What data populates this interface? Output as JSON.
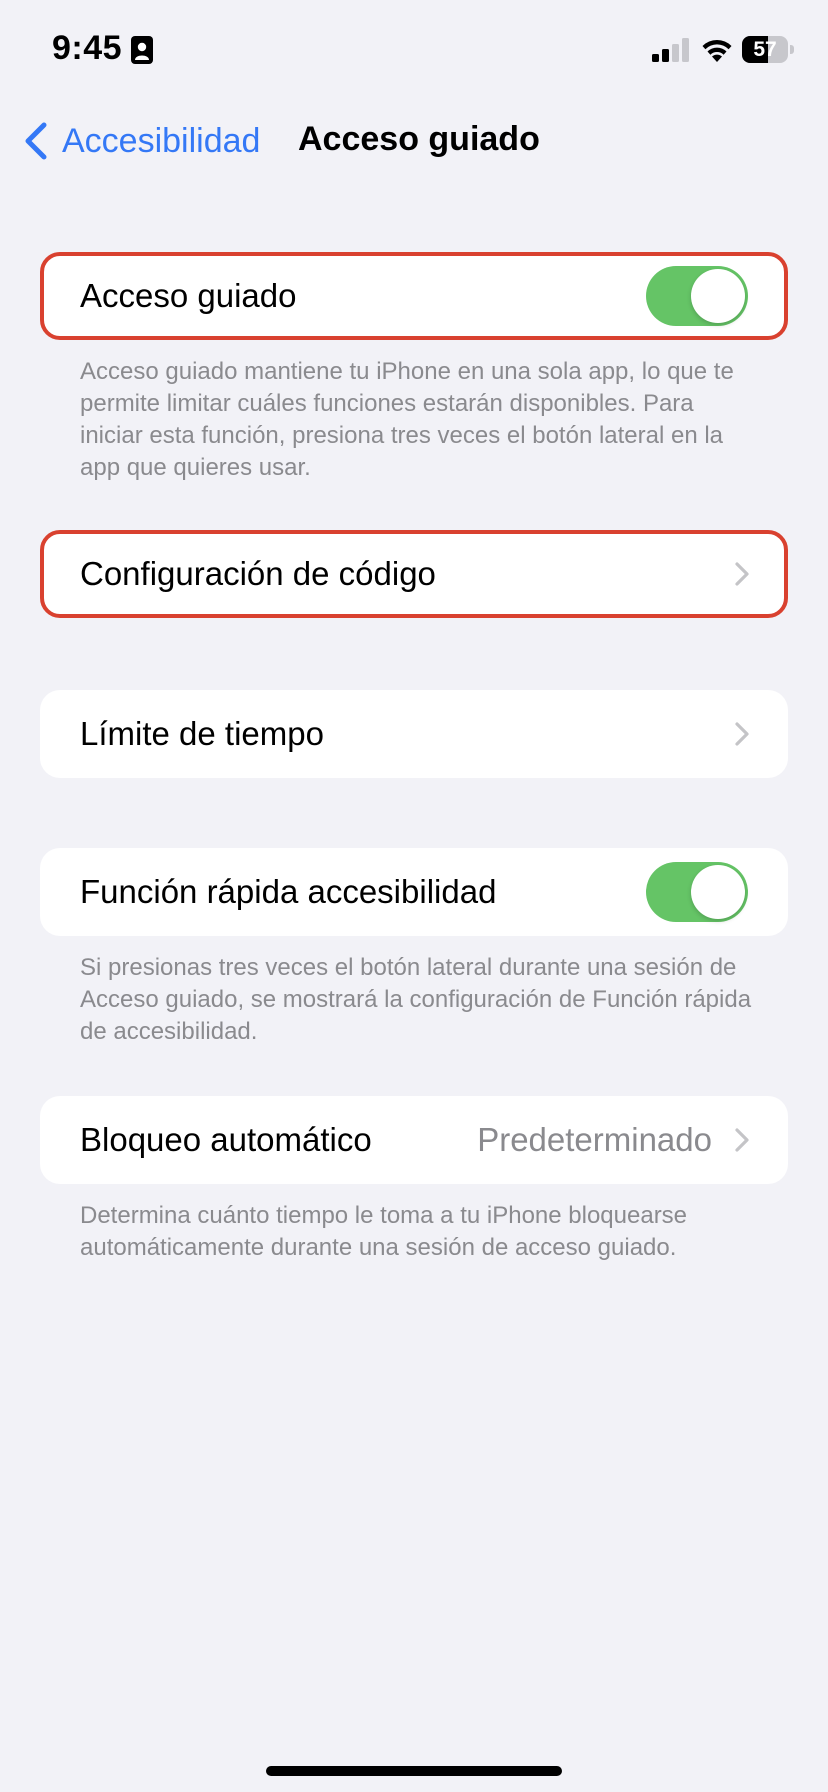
{
  "status_bar": {
    "time": "9:45",
    "battery_level": "57",
    "battery_fraction": 0.57,
    "icons": [
      "focus-person-icon",
      "cellular-signal-icon",
      "wifi-icon",
      "battery-icon"
    ]
  },
  "nav": {
    "back_label": "Accesibilidad",
    "title": "Acceso guiado",
    "back_icon": "chevron-left-icon"
  },
  "sections": {
    "guided_access": {
      "label": "Acceso guiado",
      "toggle_on": true,
      "footer": "Acceso guiado mantiene tu iPhone en una sola app, lo que te permite limitar cuáles funciones estarán disponibles. Para iniciar esta función, presiona tres veces el botón lateral en la app que quieres usar."
    },
    "passcode": {
      "label": "Configuración de código"
    },
    "time_limit": {
      "label": "Límite de tiempo"
    },
    "accessibility_shortcut": {
      "label": "Función rápida accesibilidad",
      "toggle_on": true,
      "footer": "Si presionas tres veces el botón lateral durante una sesión de Acceso guiado, se mostrará la configuración de Función rápida de accesibilidad."
    },
    "auto_lock": {
      "label": "Bloqueo automático",
      "value": "Predeterminado",
      "footer": "Determina cuánto tiempo le toma a tu iPhone bloquearse automáticamente durante una sesión de acceso guiado."
    }
  },
  "colors": {
    "accent": "#3478f6",
    "toggle_on": "#65c466",
    "highlight_border": "#d9412f",
    "background": "#f2f2f7",
    "secondary_text": "#8a8a8e"
  }
}
